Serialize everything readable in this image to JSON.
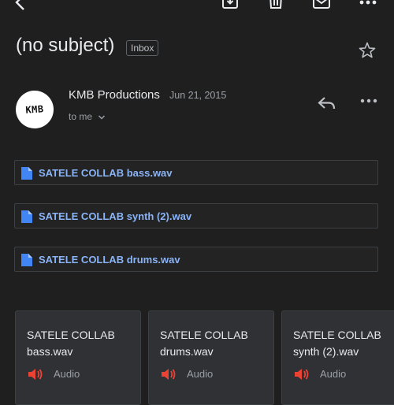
{
  "toolbar": {
    "icons": [
      "back-icon",
      "archive-icon",
      "delete-icon",
      "mark-unread-icon",
      "more-icon"
    ]
  },
  "email": {
    "subject": "(no subject)",
    "label_badge": "Inbox",
    "sender": {
      "name": "KMB Productions",
      "date": "Jun 21, 2015",
      "recipient": "to me",
      "avatar_text": "KMB"
    }
  },
  "attachments_list": [
    {
      "name": "SATELE COLLAB bass.wav"
    },
    {
      "name": "SATELE COLLAB synth (2).wav"
    },
    {
      "name": "SATELE COLLAB drums.wav"
    }
  ],
  "attachment_cards": [
    {
      "line1": "SATELE COLLAB",
      "line2": "bass.wav",
      "type": "Audio"
    },
    {
      "line1": "SATELE COLLAB",
      "line2": "drums.wav",
      "type": "Audio"
    },
    {
      "line1": "SATELE COLLAB",
      "line2": "synth (2).wav",
      "type": "Audio"
    }
  ],
  "colors": {
    "background": "#1f1f1f",
    "link": "#8ab4f8",
    "file_icon": "#4285f4",
    "audio_icon": "#ea4335"
  }
}
